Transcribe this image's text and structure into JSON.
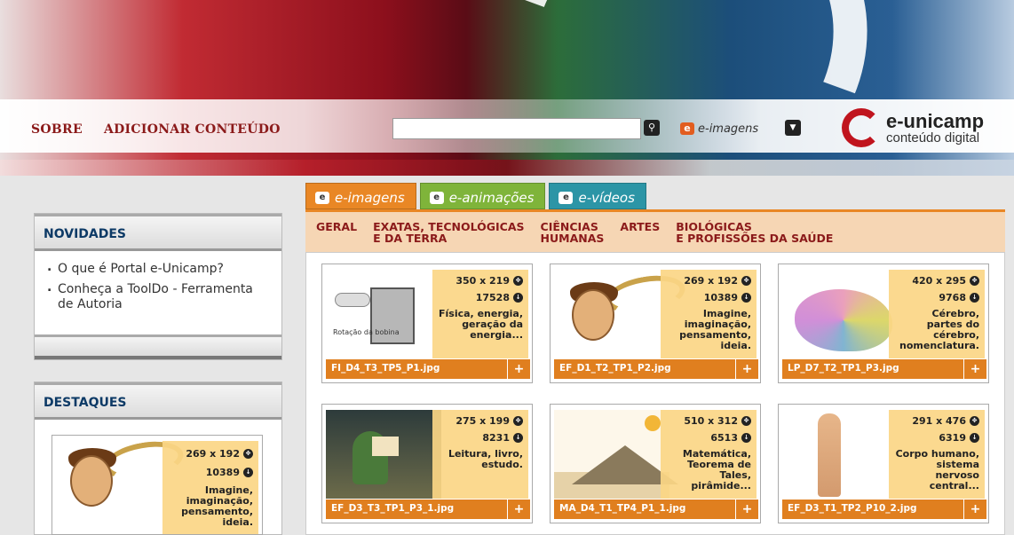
{
  "nav": {
    "about": "SOBRE",
    "add_content": "ADICIONAR CONTEÚDO"
  },
  "search": {
    "placeholder": "",
    "type_label": "e-imagens"
  },
  "brand": {
    "name": "e-unicamp",
    "tagline": "conteúdo digital"
  },
  "sidebar": {
    "news_title": "NOVIDADES",
    "news_items": [
      "O que é Portal e-Unicamp?",
      "Conheça a ToolDo - Ferramenta de Autoria"
    ],
    "highlights_title": "DESTAQUES",
    "featured": {
      "size": "269 x 192",
      "downloads": "10389",
      "description": "Imagine, imaginação, pensamento, ideia."
    }
  },
  "tabs": [
    {
      "label": "e-imagens"
    },
    {
      "label": "e-animações"
    },
    {
      "label": "e-vídeos"
    }
  ],
  "categories": [
    {
      "line1": "GERAL",
      "line2": ""
    },
    {
      "line1": "EXATAS, TECNOLÓGICAS",
      "line2": "E DA TERRA"
    },
    {
      "line1": "CIÊNCIAS",
      "line2": "HUMANAS"
    },
    {
      "line1": "ARTES",
      "line2": ""
    },
    {
      "line1": "BIOLÓGICAS",
      "line2": "E PROFISSÕES DA SAÚDE"
    }
  ],
  "cards": [
    {
      "size": "350 x 219",
      "downloads": "17528",
      "description": "Física, energia, geração da energia...",
      "file": "FI_D4_T3_TP5_P1.jpg",
      "caption": "Rotação da bobina"
    },
    {
      "size": "269 x 192",
      "downloads": "10389",
      "description": "Imagine, imaginação, pensamento, ideia.",
      "file": "EF_D1_T2_TP1_P2.jpg"
    },
    {
      "size": "420 x 295",
      "downloads": "9768",
      "description": "Cérebro, partes do cérebro, nomenclatura.",
      "file": "LP_D7_T2_TP1_P3.jpg"
    },
    {
      "size": "275 x 199",
      "downloads": "8231",
      "description": "Leitura, livro, estudo.",
      "file": "EF_D3_T3_TP1_P3_1.jpg"
    },
    {
      "size": "510 x 312",
      "downloads": "6513",
      "description": "Matemática, Teorema de Tales, pirâmide...",
      "file": "MA_D4_T1_TP4_P1_1.jpg"
    },
    {
      "size": "291 x 476",
      "downloads": "6319",
      "description": "Corpo humano, sistema nervoso central...",
      "file": "EF_D3_T1_TP2_P10_2.jpg"
    }
  ],
  "colors": {
    "accent": "#e98725",
    "brand_red": "#c0141e",
    "nav_text": "#8b1a1a",
    "tab_green": "#7fb43a",
    "tab_teal": "#2c95a6"
  }
}
